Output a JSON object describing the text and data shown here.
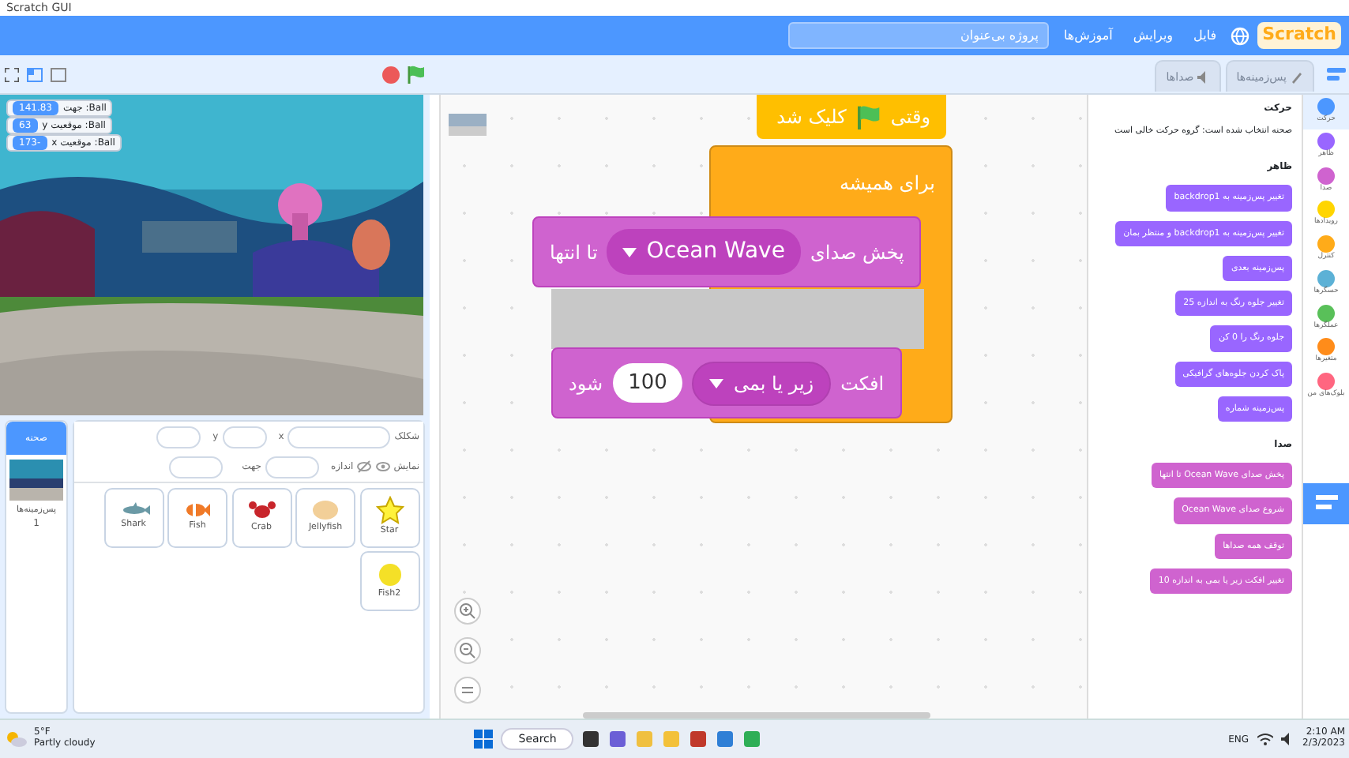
{
  "window": {
    "title": "Scratch GUI"
  },
  "menu_bar": {
    "logo": "Scratch",
    "items": [
      "فایل",
      "ویرایش",
      "آموزش‌ها"
    ],
    "project_title": "پروژه بی‌عنوان"
  },
  "editor_tabs": [
    {
      "label": "پس‌زمینه‌ها",
      "kind": "brush",
      "selected": false
    },
    {
      "label": "صداها",
      "kind": "speaker",
      "selected": false
    }
  ],
  "stage_monitors": [
    {
      "label": "Ball: جهت",
      "value": "141.83"
    },
    {
      "label": "Ball: موقعیت y",
      "value": "63"
    },
    {
      "label": "Ball: موقعیت x",
      "value": "-173"
    }
  ],
  "sprite_info": {
    "name_label": "شکلک",
    "x_label": "x",
    "y_label": "y",
    "show_label": "نمایش",
    "size_label": "اندازه",
    "direction_label": "جهت"
  },
  "sprites": [
    {
      "name": "Star",
      "kind": "star"
    },
    {
      "name": "Jellyfish",
      "kind": "blob"
    },
    {
      "name": "Crab",
      "kind": "crab"
    },
    {
      "name": "Fish",
      "kind": "fish"
    },
    {
      "name": "Shark",
      "kind": "shark"
    },
    {
      "name": "Fish2",
      "kind": "round"
    }
  ],
  "stage_pane": {
    "header": "صحنه",
    "caption": "پس‌زمینه‌ها",
    "count": "1"
  },
  "script": {
    "hat": {
      "before": "وقتی",
      "after": "کلیک شد"
    },
    "forever": "برای همیشه",
    "play": {
      "text": "پخش صدای",
      "sound": "Ocean Wave",
      "end": "تا انتها"
    },
    "effect": {
      "text": "افکت",
      "effect": "زیر یا بمی",
      "value": "100",
      "end": "شود"
    }
  },
  "palette": {
    "motion_heading": "حرکت",
    "motion_note": "صحنه انتخاب شده است: گروه حرکت خالی است",
    "looks_heading": "ظاهر",
    "looks_blocks": [
      "تغییر پس‌زمینه به backdrop1",
      "تغییر پس‌زمینه به backdrop1 و منتظر بمان",
      "پس‌زمینه بعدی",
      "تغییر جلوه رنگ به اندازه 25",
      "جلوه رنگ را 0 کن",
      "پاک کردن جلوه‌های گرافیکی",
      "پس‌زمینه شماره"
    ],
    "sound_heading": "صدا",
    "sound_blocks": [
      "پخش صدای Ocean Wave تا انتها",
      "شروع صدای Ocean Wave",
      "توقف همه صداها",
      "تغییر افکت زیر یا بمی به اندازه 10"
    ]
  },
  "categories": [
    {
      "label": "حرکت",
      "color": "#4c97ff",
      "selected": true
    },
    {
      "label": "ظاهر",
      "color": "#9966ff",
      "selected": false
    },
    {
      "label": "صدا",
      "color": "#cf63cf",
      "selected": false
    },
    {
      "label": "رویدادها",
      "color": "#ffd500",
      "selected": false
    },
    {
      "label": "کنترل",
      "color": "#ffab19",
      "selected": false
    },
    {
      "label": "حسگرها",
      "color": "#5cb1d6",
      "selected": false
    },
    {
      "label": "عملگرها",
      "color": "#59c059",
      "selected": false
    },
    {
      "label": "متغیرها",
      "color": "#ff8c1a",
      "selected": false
    },
    {
      "label": "بلوک‌های من",
      "color": "#ff6680",
      "selected": false
    }
  ],
  "taskbar": {
    "temperature": "5°F",
    "weather": "Partly cloudy",
    "search": "Search",
    "language": "ENG",
    "time": "2:10 AM",
    "date": "2/3/2023"
  }
}
